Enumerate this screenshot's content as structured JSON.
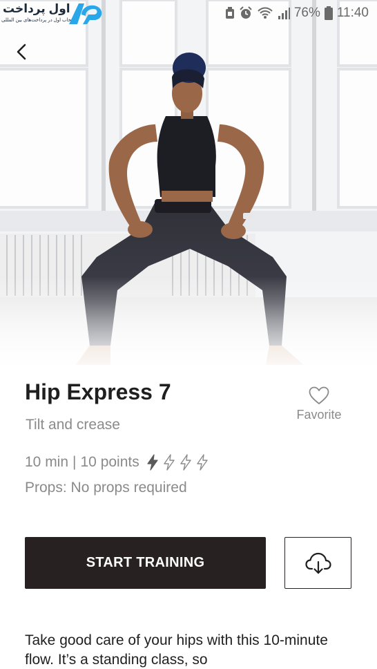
{
  "status_bar": {
    "watermark_title": "اول پرداخت",
    "watermark_subtitle": "انتخاب اول در پرداخت‌های بین المللی",
    "battery_percent": "76%",
    "time": "11:40"
  },
  "class": {
    "title": "Hip Express 7",
    "subtitle": "Tilt and crease",
    "duration": "10 min",
    "separator": "|",
    "points": "10 points",
    "intensity_level": 1,
    "intensity_max": 4,
    "props": "Props: No props required"
  },
  "favorite": {
    "label": "Favorite"
  },
  "actions": {
    "start_label": "START TRAINING"
  },
  "description": {
    "text": "Take good care of your hips with this 10-minute flow. It’s a standing class, so"
  },
  "colors": {
    "button_dark": "#272221",
    "text_primary": "#1f1f1f",
    "text_secondary": "#8a8a8a",
    "logo_blue": "#2aa7e8"
  }
}
